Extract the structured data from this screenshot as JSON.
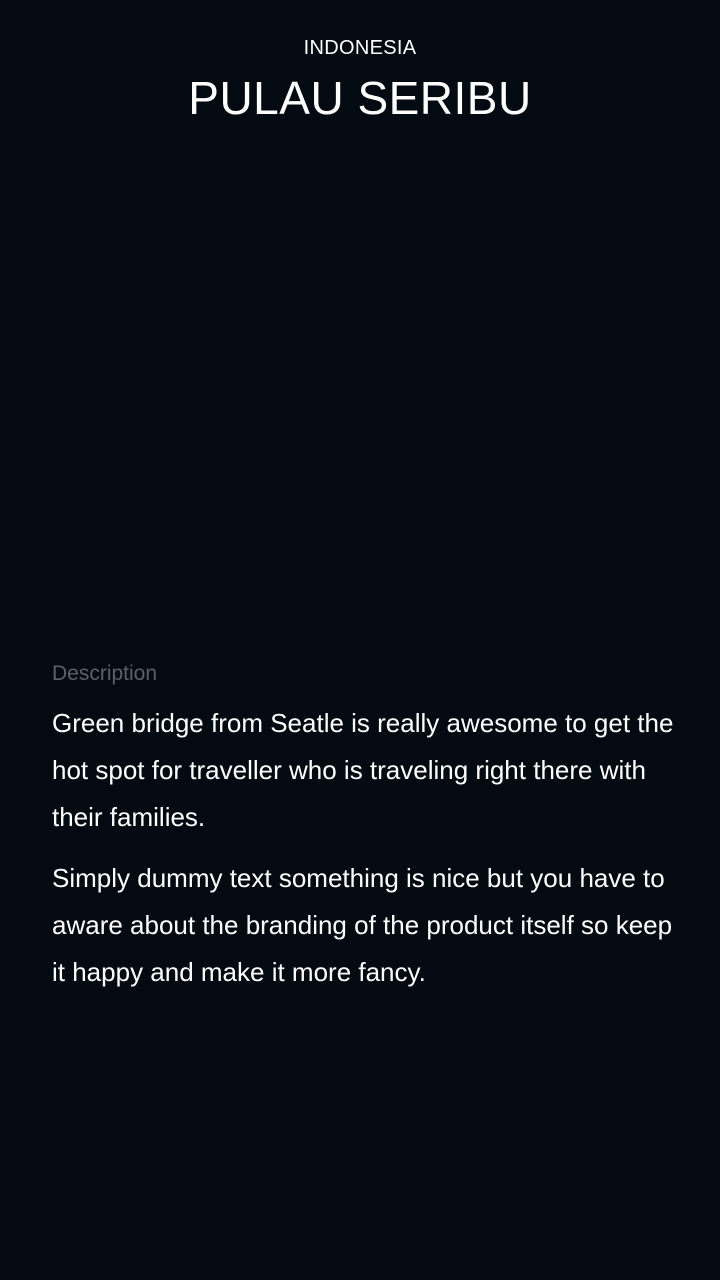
{
  "header": {
    "country": "INDONESIA",
    "title": "PULAU SERIBU"
  },
  "description": {
    "label": "Description",
    "paragraphs": [
      "Green bridge from Seatle is really awesome to get the hot spot for traveller who is traveling right there with their families.",
      "Simply dummy text something is nice but you have to aware about the branding of the product itself so keep it happy and make it more fancy."
    ]
  },
  "colors": {
    "background": "#040a12",
    "text": "#ffffff",
    "muted": "#5c6168"
  }
}
